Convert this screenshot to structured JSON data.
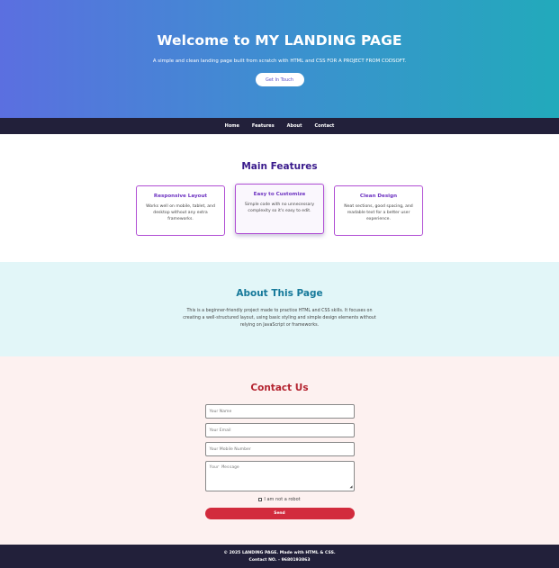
{
  "hero": {
    "title": "Welcome to MY LANDING PAGE",
    "subtitle": "A simple and clean landing page built from scratch with HTML and CSS FOR A PROJECT FROM CODSOFT.",
    "cta_label": "Get In Touch"
  },
  "nav": {
    "items": [
      {
        "label": "Home"
      },
      {
        "label": "Features"
      },
      {
        "label": "About"
      },
      {
        "label": "Contact"
      }
    ]
  },
  "features": {
    "heading": "Main Features",
    "cards": [
      {
        "title": "Responsive Layout",
        "desc": "Works well on mobile, tablet, and desktop without any extra frameworks."
      },
      {
        "title": "Easy to Customize",
        "desc": "Simple code with no unnecessary complexity so it's easy to edit."
      },
      {
        "title": "Clean Design",
        "desc": "Neat sections, good spacing, and readable text for a better user experience."
      }
    ]
  },
  "about": {
    "heading": "About This Page",
    "body": "This is a beginner-friendly project made to practice HTML and CSS skills. It focuses on creating a well-structured layout, using basic styling and simple design elements without relying on JavaScript or frameworks."
  },
  "contact": {
    "heading": "Contact Us",
    "name_placeholder": "Your Name",
    "email_placeholder": "Your Email",
    "mobile_placeholder": "Your Mobile Number",
    "message_placeholder": "Your Message",
    "robot_label": "I am not a robot",
    "submit_label": "Send"
  },
  "footer": {
    "copyright": "© 2025 LANDING PAGE. Made with HTML & CSS.",
    "contact_no": "Contact NO. - 9680193863"
  },
  "colors": {
    "hero_gradient_start": "#5b6fe0",
    "hero_gradient_end": "#22aabb",
    "nav_bg": "#22203a",
    "features_heading": "#3a1b8c",
    "card_border": "#b04ed4",
    "about_bg": "#e2f6f8",
    "about_heading": "#16799a",
    "contact_bg": "#fdf1f0",
    "contact_heading": "#b42430",
    "submit_bg": "#d22b3d"
  }
}
